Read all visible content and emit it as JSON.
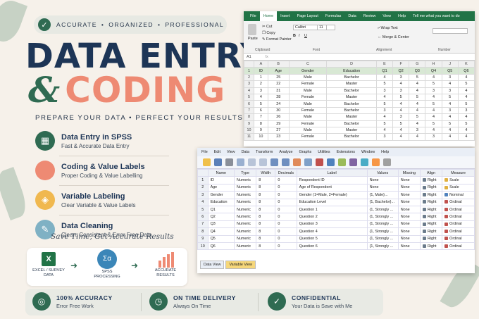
{
  "badges": {
    "b1": "ACCURATE",
    "b2": "ORGANIZED",
    "b3": "PROFESSIONAL",
    "sep": "•"
  },
  "title": {
    "line1": "DATA ENTRY",
    "amp": "&",
    "line2": "CODING"
  },
  "subtitle": "PREPARE YOUR DATA  •  PERFECT YOUR RESULTS",
  "features": [
    {
      "title": "Data Entry in SPSS",
      "desc": "Fast & Accurate Data Entry",
      "color": "#2f6b52",
      "icon": "grid-icon"
    },
    {
      "title": "Coding & Value Labels",
      "desc": "Proper Coding & Value Labelling",
      "color": "#ee8a73",
      "icon": "code-icon"
    },
    {
      "title": "Variable Labeling",
      "desc": "Clear Variable & Value Labels",
      "color": "#f0b84f",
      "icon": "tag-icon"
    },
    {
      "title": "Data Cleaning",
      "desc": "Clean, Consistent & Error Free Data",
      "color": "#7fb1c4",
      "icon": "broom-icon"
    }
  ],
  "tagline": "Save Time, Get Accurate Results",
  "flow": {
    "s1": "EXCEL / SURVEY\nDATA",
    "s2": "SPSS\nPROCESSING",
    "s3": "ACCURATE\nRESULTS",
    "spss_glyph": "Σα"
  },
  "bottom": [
    {
      "title": "100% ACCURACY",
      "desc": "Error Free Work",
      "icon": "target-icon"
    },
    {
      "title": "ON TIME DELIVERY",
      "desc": "Always On Time",
      "icon": "clock-icon"
    },
    {
      "title": "CONFIDENTIAL",
      "desc": "Your Data is Save with Me",
      "icon": "shield-icon"
    }
  ],
  "excel": {
    "tabs": [
      "File",
      "Home",
      "Insert",
      "Page Layout",
      "Formulas",
      "Data",
      "Review",
      "View",
      "Help",
      "Tell me what you want to do"
    ],
    "ribbon": {
      "paste": "Paste",
      "cut": "Cut",
      "copy": "Copy",
      "painter": "Format Painter",
      "font": "Calibri",
      "size": "11",
      "wrap": "Wrap Text",
      "merge": "Merge & Center",
      "groups": [
        "Clipboard",
        "Font",
        "Alignment",
        "Number"
      ]
    },
    "namebox": "A1",
    "cols": [
      "A",
      "B",
      "C",
      "D",
      "E",
      "F",
      "G",
      "H",
      "J",
      "K"
    ],
    "rows": [
      [
        "ID",
        "Age",
        "Gender",
        "Education",
        "Q1",
        "Q2",
        "Q3",
        "Q4",
        "Q5",
        "Q6"
      ],
      [
        "1",
        "25",
        "Male",
        "Bachelor",
        "4",
        "3",
        "5",
        "4",
        "3",
        "4"
      ],
      [
        "2",
        "22",
        "Female",
        "Master",
        "5",
        "4",
        "4",
        "5",
        "4",
        "5"
      ],
      [
        "3",
        "31",
        "Male",
        "Bachelor",
        "3",
        "3",
        "4",
        "3",
        "3",
        "4"
      ],
      [
        "4",
        "28",
        "Female",
        "Master",
        "4",
        "5",
        "5",
        "4",
        "5",
        "4"
      ],
      [
        "5",
        "24",
        "Male",
        "Bachelor",
        "5",
        "4",
        "4",
        "5",
        "4",
        "5"
      ],
      [
        "6",
        "30",
        "Female",
        "Bachelor",
        "3",
        "4",
        "4",
        "4",
        "3",
        "3"
      ],
      [
        "7",
        "26",
        "Male",
        "Master",
        "4",
        "3",
        "5",
        "4",
        "4",
        "4"
      ],
      [
        "8",
        "29",
        "Female",
        "Bachelor",
        "5",
        "5",
        "4",
        "5",
        "5",
        "5"
      ],
      [
        "9",
        "27",
        "Male",
        "Master",
        "4",
        "4",
        "3",
        "4",
        "4",
        "4"
      ],
      [
        "10",
        "23",
        "Female",
        "Bachelor",
        "3",
        "4",
        "4",
        "3",
        "4",
        "4"
      ]
    ]
  },
  "spss": {
    "menu": [
      "File",
      "Edit",
      "View",
      "Data",
      "Transform",
      "Analyze",
      "Graphs",
      "Utilities",
      "Extensions",
      "Window",
      "Help"
    ],
    "headers": [
      "",
      "Name",
      "Type",
      "Width",
      "Decimals",
      "Label",
      "Values",
      "Missing",
      "Align",
      "Measure"
    ],
    "rows": [
      [
        "1",
        "ID",
        "Numeric",
        "8",
        "0",
        "Respondent ID",
        "None",
        "None",
        "Right",
        "Scale"
      ],
      [
        "2",
        "Age",
        "Numeric",
        "8",
        "0",
        "Age of Respondent",
        "None",
        "None",
        "Right",
        "Scale"
      ],
      [
        "3",
        "Gender",
        "Numeric",
        "8",
        "0",
        "Gender (1=Male, 2=Female)",
        "{1, Male}...",
        "None",
        "Right",
        "Nominal"
      ],
      [
        "4",
        "Education",
        "Numeric",
        "8",
        "0",
        "Education Level",
        "{1, Bachelor}...",
        "None",
        "Right",
        "Ordinal"
      ],
      [
        "5",
        "Q1",
        "Numeric",
        "8",
        "0",
        "Question 1",
        "{1, Strongly ...",
        "None",
        "Right",
        "Ordinal"
      ],
      [
        "6",
        "Q2",
        "Numeric",
        "8",
        "0",
        "Question 2",
        "{1, Strongly ...",
        "None",
        "Right",
        "Ordinal"
      ],
      [
        "7",
        "Q3",
        "Numeric",
        "8",
        "0",
        "Question 3",
        "{1, Strongly ...",
        "None",
        "Right",
        "Ordinal"
      ],
      [
        "8",
        "Q4",
        "Numeric",
        "8",
        "0",
        "Question 4",
        "{1, Strongly ...",
        "None",
        "Right",
        "Ordinal"
      ],
      [
        "9",
        "Q5",
        "Numeric",
        "8",
        "0",
        "Question 5",
        "{1, Strongly ...",
        "None",
        "Right",
        "Ordinal"
      ],
      [
        "10",
        "Q6",
        "Numeric",
        "8",
        "0",
        "Question 6",
        "{1, Strongly ...",
        "None",
        "Right",
        "Ordinal"
      ]
    ],
    "view_tabs": [
      "Data View",
      "Variable View"
    ]
  }
}
